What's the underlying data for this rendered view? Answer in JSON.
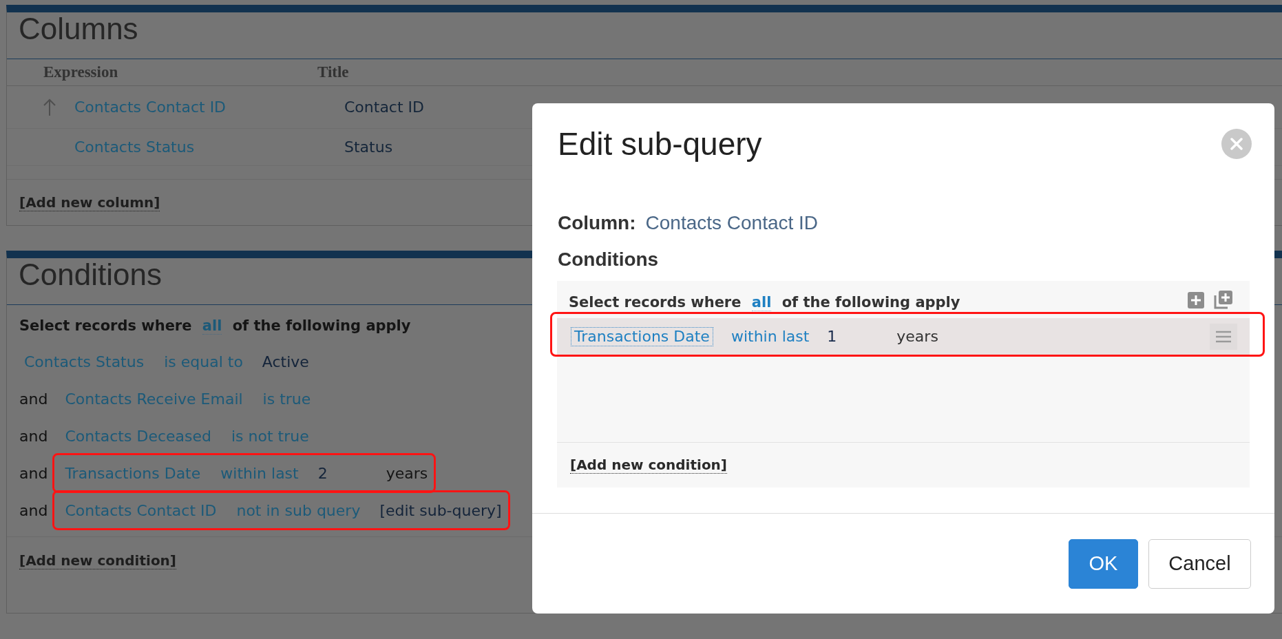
{
  "columns_panel": {
    "title": "Columns",
    "table": {
      "columns": [
        "Expression",
        "Title"
      ],
      "rows": [
        {
          "expression": "Contacts Contact ID",
          "title": "Contact ID",
          "sorted": true
        },
        {
          "expression": "Contacts Status",
          "title": "Status",
          "sorted": false
        }
      ]
    },
    "add_link": "[Add new column]"
  },
  "conditions_panel": {
    "title": "Conditions",
    "intro": {
      "before": "Select records where",
      "quantifier": "all",
      "after": "of the following apply"
    },
    "rows": [
      {
        "field": "Contacts Status",
        "operator": "is equal to",
        "value": "Active",
        "highlighted": false
      },
      {
        "joiner": "and",
        "field": "Contacts Receive Email",
        "operator": "is true",
        "highlighted": false
      },
      {
        "joiner": "and",
        "field": "Contacts Deceased",
        "operator": "is not true",
        "highlighted": false
      },
      {
        "joiner": "and",
        "field": "Transactions Date",
        "operator": "within last",
        "value": "2",
        "unit": "years",
        "highlighted": true
      },
      {
        "joiner": "and",
        "field": "Contacts Contact ID",
        "operator": "not in sub query",
        "action": "[edit sub-query]",
        "highlighted": true
      }
    ],
    "add_link": "[Add new condition]"
  },
  "dialog": {
    "title": "Edit sub-query",
    "column_label": "Column:",
    "column_value": "Contacts Contact ID",
    "conditions_heading": "Conditions",
    "intro": {
      "before": "Select records where",
      "quantifier": "all",
      "after": "of the following apply"
    },
    "rows": [
      {
        "field": "Transactions Date",
        "operator": "within last",
        "value": "1",
        "unit": "years",
        "highlighted": true,
        "focused": true
      }
    ],
    "add_link": "[Add new condition]",
    "buttons": [
      {
        "label": "OK",
        "kind": "primary"
      },
      {
        "label": "Cancel",
        "kind": "secondary"
      }
    ]
  }
}
